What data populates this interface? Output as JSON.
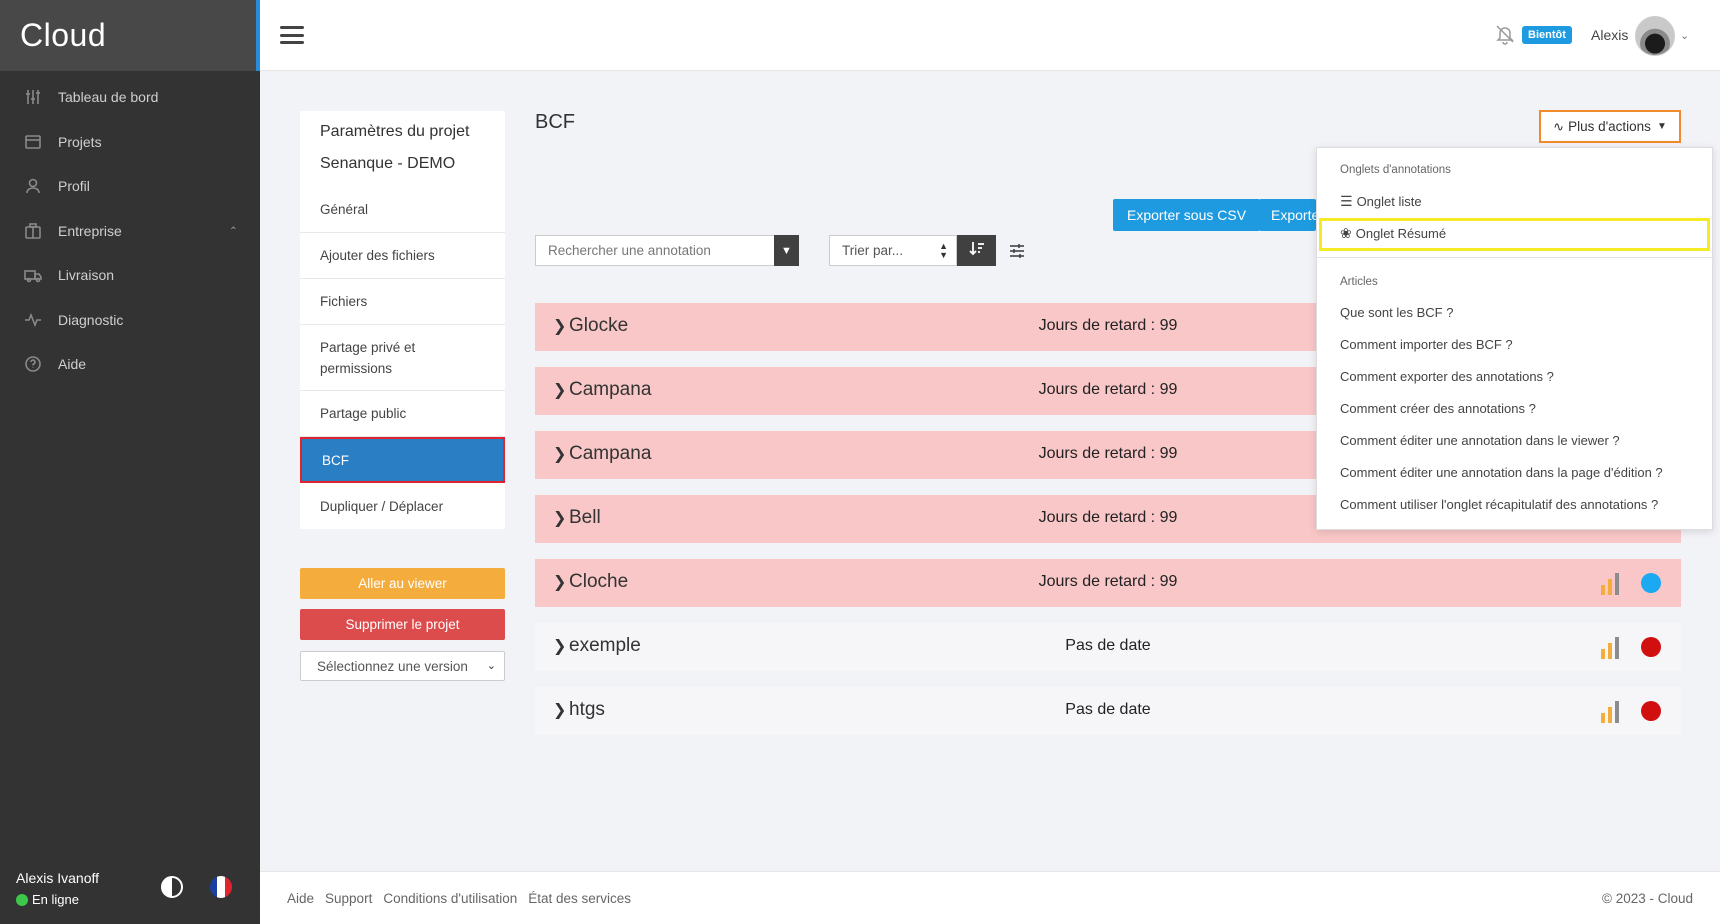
{
  "brand": "Cloud",
  "nav": [
    {
      "label": "Tableau de bord",
      "icon": "sliders-icon"
    },
    {
      "label": "Projets",
      "icon": "folder-icon"
    },
    {
      "label": "Profil",
      "icon": "user-icon"
    },
    {
      "label": "Entreprise",
      "icon": "building-icon",
      "caret": "^"
    },
    {
      "label": "Livraison",
      "icon": "truck-icon"
    },
    {
      "label": "Diagnostic",
      "icon": "pulse-icon"
    },
    {
      "label": "Aide",
      "icon": "help-icon"
    }
  ],
  "sidebar_user": {
    "name": "Alexis Ivanoff",
    "status": "En ligne"
  },
  "topbar": {
    "badge": "Bientôt",
    "user": "Alexis"
  },
  "settings": {
    "title": "Paramètres du projet",
    "project": "Senanque - DEMO",
    "items": [
      "Général",
      "Ajouter des fichiers",
      "Fichiers",
      "Partage privé et permissions",
      "Partage public",
      "BCF",
      "Dupliquer / Déplacer"
    ],
    "active": "BCF",
    "btn_viewer": "Aller au viewer",
    "btn_delete": "Supprimer le projet",
    "version_select": "Sélectionnez une version"
  },
  "main": {
    "title": "BCF",
    "actions_label": "Plus d'actions",
    "export_csv": "Exporter sous CSV",
    "export_other": "Exporte",
    "search_placeholder": "Rechercher une annotation",
    "sort_label": "Trier par..."
  },
  "annotations": [
    {
      "name": "Glocke",
      "status": "Jours de retard : 99",
      "late": true,
      "state_color": "#1e9be0"
    },
    {
      "name": "Campana",
      "status": "Jours de retard : 99",
      "late": true,
      "state_color": "#1e9be0"
    },
    {
      "name": "Campana",
      "status": "Jours de retard : 99",
      "late": true,
      "state_color": "#1e9be0"
    },
    {
      "name": "Bell",
      "status": "Jours de retard : 99",
      "late": true,
      "state_color": "#1e9be0"
    },
    {
      "name": "Cloche",
      "status": "Jours de retard : 99",
      "late": true,
      "state_color": "#1ba9f2"
    },
    {
      "name": "exemple",
      "status": "Pas de date",
      "late": false,
      "state_color": "#d20f0f"
    },
    {
      "name": "htgs",
      "status": "Pas de date",
      "late": false,
      "state_color": "#d20f0f"
    }
  ],
  "dropdown": {
    "section1": "Onglets d'annotations",
    "tab_list": "Onglet liste",
    "tab_summary": "Onglet Résumé",
    "section2": "Articles",
    "articles": [
      "Que sont les BCF ?",
      "Comment importer des BCF ?",
      "Comment exporter des annotations ?",
      "Comment créer des annotations ?",
      "Comment éditer une annotation dans le viewer ?",
      "Comment éditer une annotation dans la page d'édition ?",
      "Comment utiliser l'onglet récapitulatif des annotations ?"
    ]
  },
  "footer": {
    "links": [
      "Aide",
      "Support",
      "Conditions d'utilisation",
      "État des services"
    ],
    "copyright": "© 2023 - Cloud"
  },
  "colors": {
    "accent": "#1e9be0",
    "late_row": "#f9c7c7",
    "sidebar": "#333333",
    "priority_orange": "#f4ad3d",
    "priority_gray": "#8c8c8c"
  }
}
